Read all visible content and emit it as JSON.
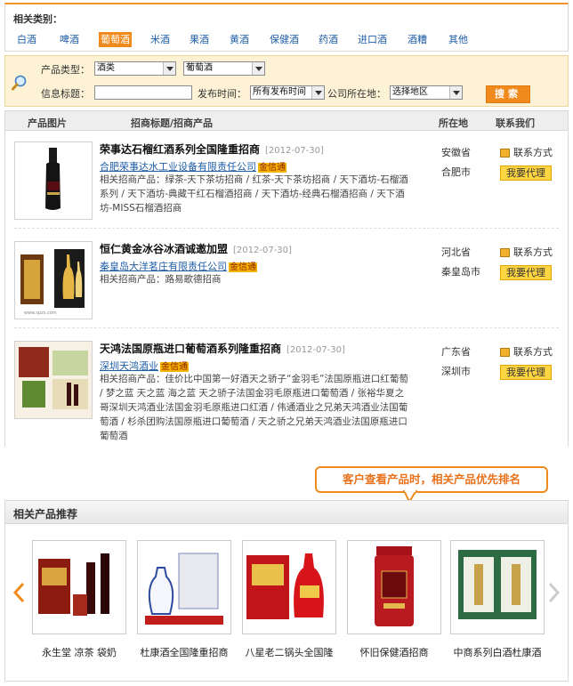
{
  "categories": {
    "title": "相关类别：",
    "items": [
      {
        "label": "白酒",
        "active": false
      },
      {
        "label": "啤酒",
        "active": false
      },
      {
        "label": "葡萄酒",
        "active": true
      },
      {
        "label": "米酒",
        "active": false
      },
      {
        "label": "果酒",
        "active": false
      },
      {
        "label": "黄酒",
        "active": false
      },
      {
        "label": "保健酒",
        "active": false
      },
      {
        "label": "药酒",
        "active": false
      },
      {
        "label": "进口酒",
        "active": false
      },
      {
        "label": "酒糟",
        "active": false
      },
      {
        "label": "其他",
        "active": false
      }
    ]
  },
  "search": {
    "product_type_label": "产品类型：",
    "product_type_value": "酒类",
    "product_subtype_value": "葡萄酒",
    "info_title_label": "信息标题：",
    "info_title_value": "",
    "publish_time_label": "发布时间：",
    "publish_time_value": "所有发布时间",
    "company_location_label": "公司所在地：",
    "company_location_value": "选择地区",
    "search_button": "搜索"
  },
  "results": {
    "headers": {
      "image": "产品图片",
      "title": "招商标题/招商产品",
      "location": "所在地",
      "contact": "联系我们"
    },
    "items": [
      {
        "title": "荣事达石榴红酒系列全国隆重招商",
        "date": "[2012-07-30]",
        "company": "合肥荣事达水工业设备有限责任公司",
        "badge": "金信通",
        "desc": "相关招商产品：绿茶-天下茶坊招商 / 红茶-天下茶坊招商 / 天下酒坊-石榴酒系列 / 天下酒坊-典藏干红石榴酒招商 / 天下酒坊-经典石榴酒招商 / 天下酒坊-MISS石榴酒招商",
        "province": "安徽省",
        "city": "合肥市",
        "contact_label": "联系方式",
        "agent_label": "我要代理"
      },
      {
        "title": "恒仁黄金冰谷冰酒诚邀加盟",
        "date": "[2012-07-30]",
        "company": "秦皇岛大洋茗庄有限责任公司",
        "badge": "金信通",
        "desc": "相关招商产品：路易歌德招商",
        "province": "河北省",
        "city": "秦皇岛市",
        "contact_label": "联系方式",
        "agent_label": "我要代理"
      },
      {
        "title": "天鸿法国原瓶进口葡萄酒系列隆重招商",
        "date": "[2012-07-30]",
        "company": "深圳天鸿酒业",
        "badge": "金信通",
        "desc": "相关招商产品：佳价比中国第一好酒天之骄子“金羽毛”法国原瓶进口红葡萄 / 梦之蓝 天之蓝 海之蓝 天之骄子法国金羽毛原瓶进口葡萄酒 / 张裕华夏之哥深圳天鸿酒业法国金羽毛原瓶进口红酒 / 伟通酒业之兄弟天鸿酒业法国葡萄酒 / 杉杀团购法国原瓶进口葡萄酒 / 天之骄之兄弟天鸿酒业法国原瓶进口葡萄酒",
        "province": "广东省",
        "city": "深圳市",
        "contact_label": "联系方式",
        "agent_label": "我要代理"
      }
    ]
  },
  "callout": "客户查看产品时，相关产品优先排名",
  "related": {
    "title": "相关产品推荐",
    "products": [
      {
        "name": "永生堂 凉茶 袋奶"
      },
      {
        "name": "杜康酒全国隆重招商"
      },
      {
        "name": "八星老二锅头全国隆"
      },
      {
        "name": "怀旧保健酒招商"
      },
      {
        "name": "中商系列白酒杜康酒"
      }
    ]
  },
  "colors": {
    "accent": "#f08a1c",
    "link": "#1f5ea8",
    "badge": "#f6b400",
    "search_bg": "#fdf2d6"
  }
}
